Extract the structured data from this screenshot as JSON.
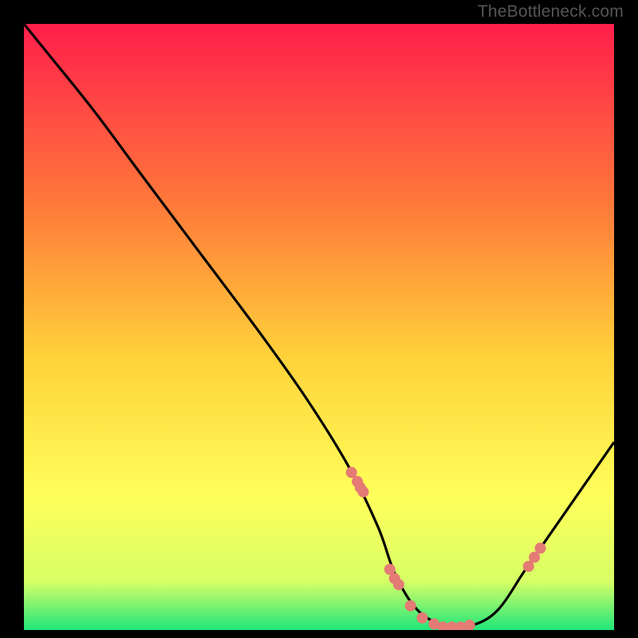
{
  "attribution": "TheBottleneck.com",
  "chart_data": {
    "type": "line",
    "title": "",
    "xlabel": "",
    "ylabel": "",
    "xlim": [
      0,
      100
    ],
    "ylim": [
      0,
      100
    ],
    "gradient_stops": [
      {
        "offset": 0,
        "color": "#ff1f4b"
      },
      {
        "offset": 30,
        "color": "#ff7a3a"
      },
      {
        "offset": 55,
        "color": "#ffd23a"
      },
      {
        "offset": 78,
        "color": "#ffff5a"
      },
      {
        "offset": 92,
        "color": "#d7ff66"
      },
      {
        "offset": 100,
        "color": "#1fe67a"
      }
    ],
    "series": [
      {
        "name": "bottleneck-curve",
        "x": [
          0,
          5,
          12,
          20,
          30,
          40,
          48,
          55,
          60,
          63,
          67,
          72,
          75,
          80,
          85,
          90,
          95,
          100
        ],
        "values": [
          100,
          94,
          85.5,
          75,
          62,
          49,
          38,
          27,
          17,
          9,
          3,
          0.5,
          0.5,
          3,
          10,
          17,
          24,
          31
        ]
      }
    ],
    "markers": {
      "name": "highlight-points",
      "color": "#e47b75",
      "radius": 7,
      "x": [
        55.5,
        56.5,
        57.0,
        57.5,
        62.0,
        62.8,
        63.5,
        65.5,
        67.5,
        69.5,
        71.0,
        72.5,
        74.0,
        75.5,
        85.5,
        86.5,
        87.5
      ],
      "values": [
        26.0,
        24.5,
        23.5,
        22.8,
        10.0,
        8.5,
        7.5,
        4.0,
        2.0,
        1.0,
        0.5,
        0.5,
        0.5,
        0.8,
        10.5,
        12.0,
        13.5
      ]
    }
  }
}
